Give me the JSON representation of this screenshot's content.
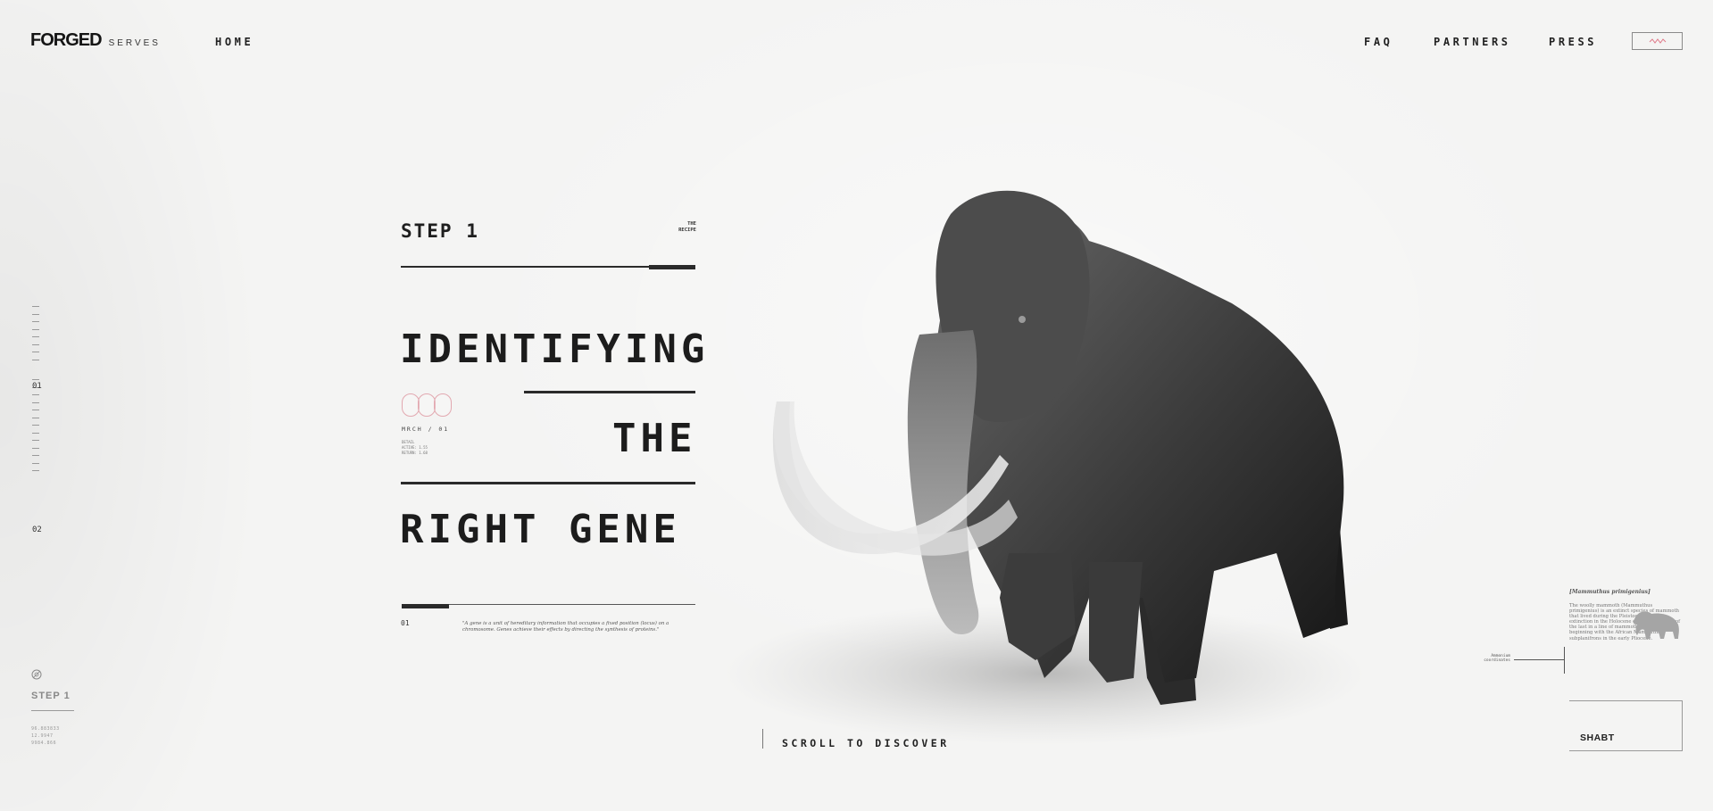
{
  "header": {
    "logo": "FORGED",
    "logo_sub": "SERVES",
    "nav_left": [
      "HOME"
    ],
    "nav_right": [
      "FAQ",
      "PARTNERS",
      "PRESS"
    ],
    "menu_icon": "squiggle-menu-icon",
    "accent_color": "#e07a8a"
  },
  "rail": {
    "labels": [
      "01",
      "02"
    ],
    "current_step": "STEP 1",
    "coords": [
      "96.883833",
      "12.9947",
      "9984.866"
    ]
  },
  "main": {
    "step_title": "STEP 1",
    "recipe_label": [
      "THE",
      "RECIPE"
    ],
    "heading_lines": [
      "IDENTIFYING",
      "THE",
      "RIGHT GENE"
    ],
    "mark_code": "MRCH / 01",
    "mark_meta": [
      "DETAIL",
      "ACTIVE: 1.55",
      "RETURN: 1.68"
    ],
    "footnote_number": "01",
    "quote": "\"A gene is a unit of hereditary information that occupies a fixed position (locus) on a chromosome. Genes achieve their effects by directing the synthesis of proteins.\"",
    "scroll_cta": "SCROLL TO DISCOVER"
  },
  "info_card": {
    "species_title": "[Mammuthus primigenius]",
    "species_text": "The woolly mammoth (Mammuthus primigenius) is an extinct species of mammoth that lived during the Pleistocene until its extinction in the Holocene epoch. It was one of the last in a line of mammoth species, beginning with the African Mammuthus subplanifrons in the early Pliocene.",
    "pointer_label": [
      "Ammonium",
      "coordinates"
    ],
    "shabt_label": "SHABT"
  }
}
